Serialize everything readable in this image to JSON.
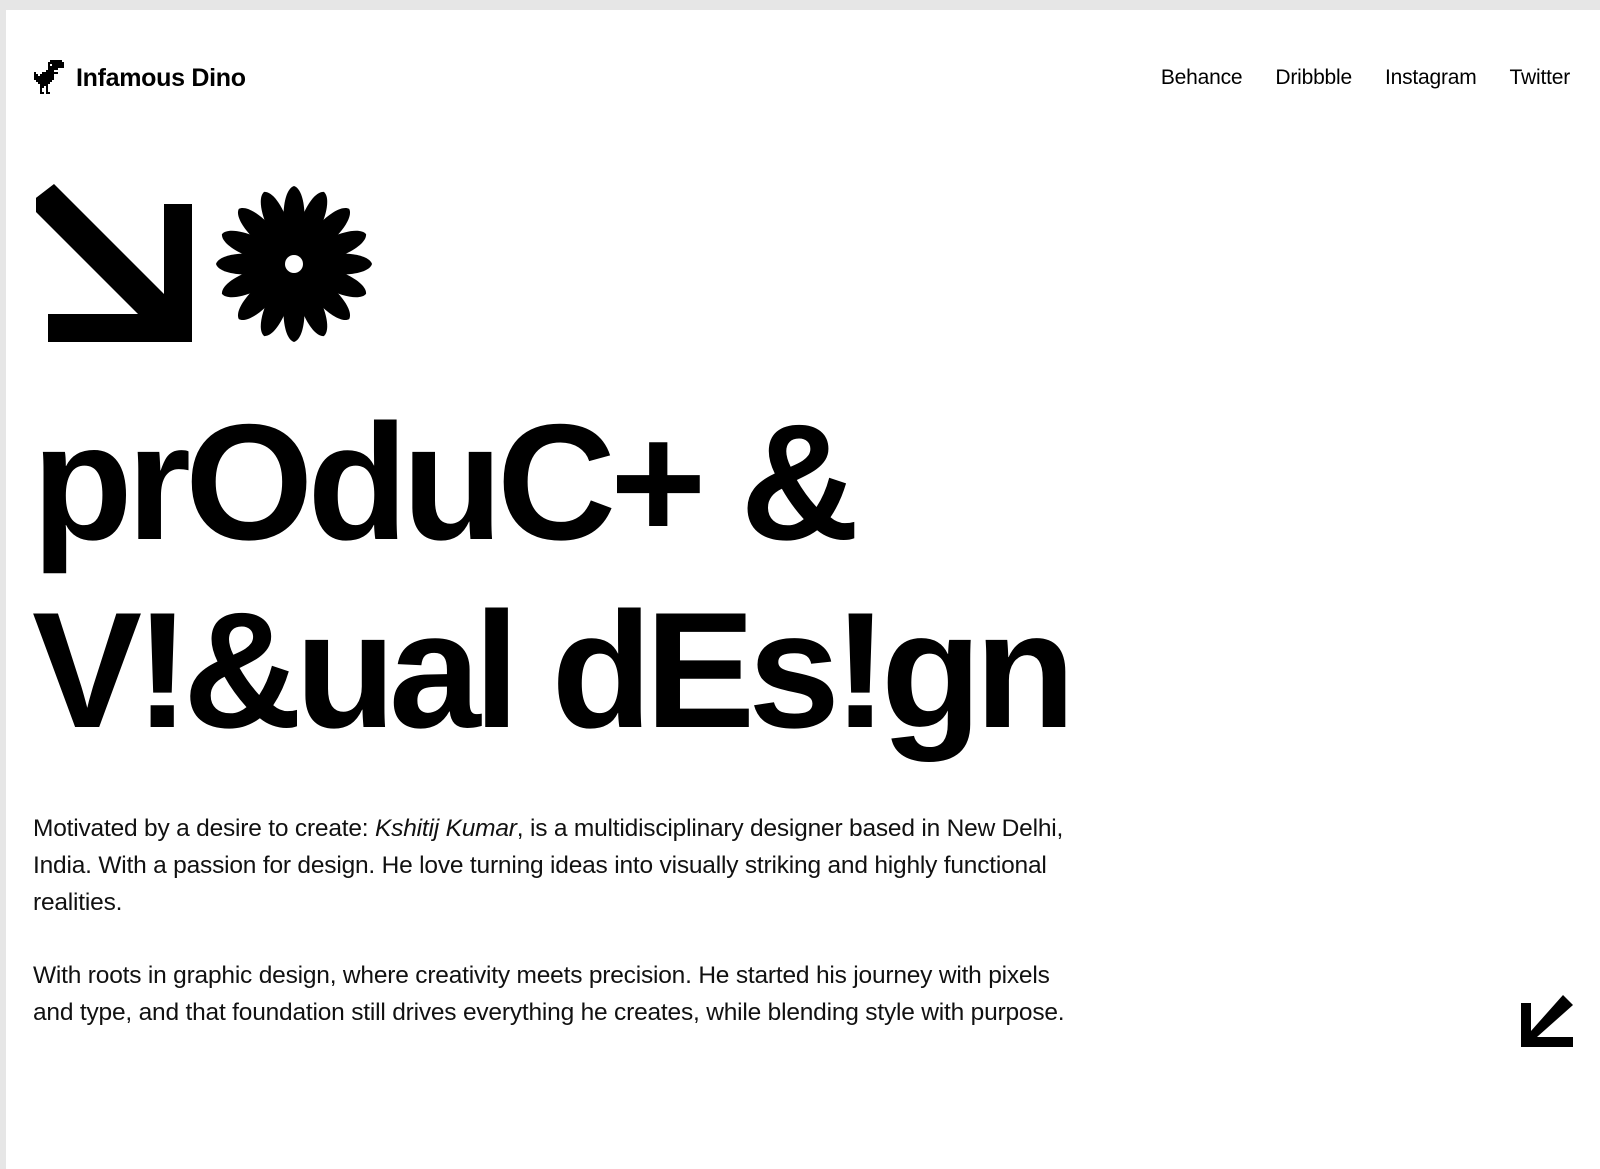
{
  "header": {
    "brand_name": "Infamous Dino",
    "brand_icon": "dino-icon",
    "nav": [
      {
        "label": "Behance"
      },
      {
        "label": "Dribbble"
      },
      {
        "label": "Instagram"
      },
      {
        "label": "Twitter"
      }
    ]
  },
  "hero": {
    "icons": [
      "arrow-down-right-icon",
      "flower-icon"
    ],
    "headline_line1": "prOduC+ &",
    "headline_line2": "V!&ual dEs!gn"
  },
  "bio": {
    "p1_prefix": "Motivated by a desire to create: ",
    "p1_name": "Kshitij Kumar",
    "p1_suffix": ", is a multidisciplinary designer based in New Delhi, India. With a passion for design. He love turning ideas into visually striking and highly functional realities.",
    "p2": "With roots in graphic design, where creativity meets precision. He started his journey with pixels and type, and that foundation still drives everything he creates, while blending style with purpose."
  },
  "footer_icon": "arrow-down-left-icon",
  "colors": {
    "background": "#ffffff",
    "frame": "#e6e6e6",
    "text": "#000000"
  }
}
